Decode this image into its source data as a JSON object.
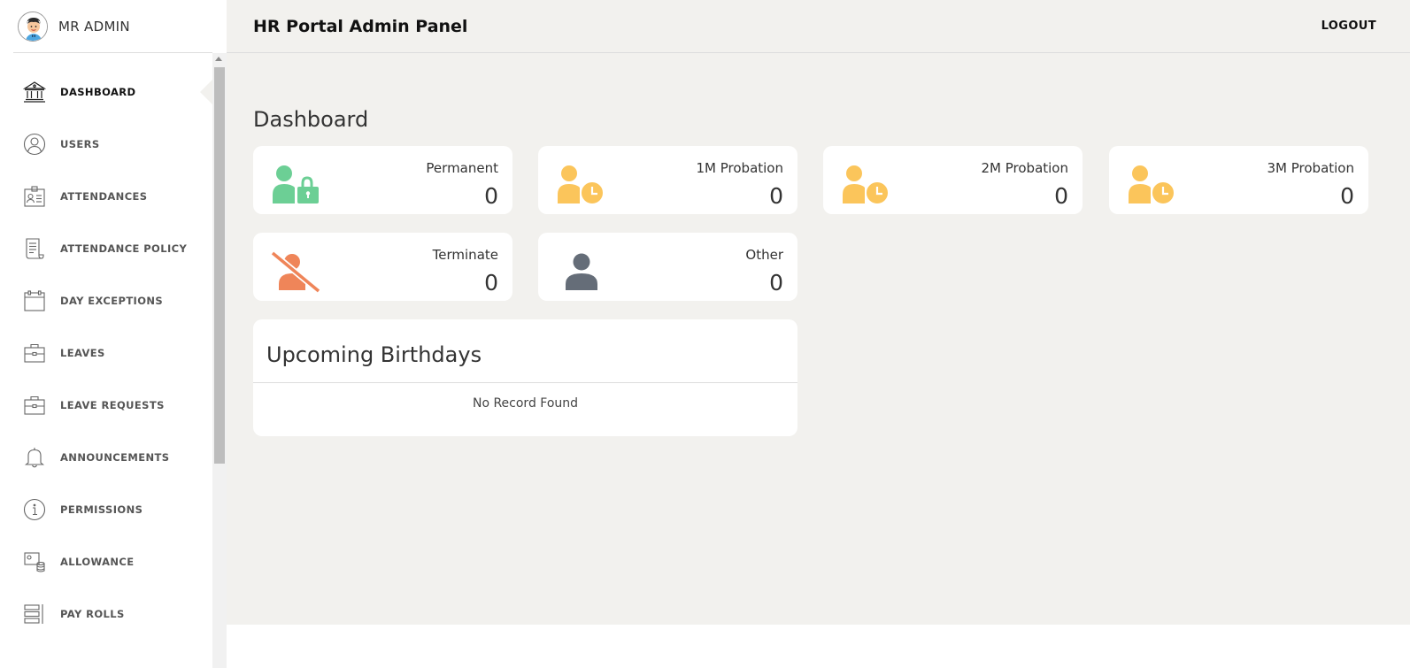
{
  "sidebar": {
    "user_name": "MR ADMIN",
    "items": [
      {
        "label": "DASHBOARD",
        "icon": "bank-icon"
      },
      {
        "label": "USERS",
        "icon": "user-circle-icon"
      },
      {
        "label": "ATTENDANCES",
        "icon": "id-card-icon"
      },
      {
        "label": "ATTENDANCE POLICY",
        "icon": "document-icon"
      },
      {
        "label": "DAY EXCEPTIONS",
        "icon": "calendar-icon"
      },
      {
        "label": "LEAVES",
        "icon": "briefcase-icon"
      },
      {
        "label": "LEAVE REQUESTS",
        "icon": "briefcase-icon"
      },
      {
        "label": "ANNOUNCEMENTS",
        "icon": "bell-icon"
      },
      {
        "label": "PERMISSIONS",
        "icon": "info-icon"
      },
      {
        "label": "ALLOWANCE",
        "icon": "allowance-icon"
      },
      {
        "label": "PAY ROLLS",
        "icon": "payroll-icon"
      }
    ],
    "active_item": "DASHBOARD"
  },
  "header": {
    "title": "HR Portal Admin Panel",
    "logout_label": "LOGOUT"
  },
  "main": {
    "page_title": "Dashboard",
    "stats": [
      {
        "label": "Permanent",
        "value": "0",
        "icon": "user-lock-icon",
        "color": "#6ccf95"
      },
      {
        "label": "1M Probation",
        "value": "0",
        "icon": "user-clock-icon",
        "color": "#fbc55b"
      },
      {
        "label": "2M Probation",
        "value": "0",
        "icon": "user-clock-icon",
        "color": "#fbc55b"
      },
      {
        "label": "3M Probation",
        "value": "0",
        "icon": "user-clock-icon",
        "color": "#fbc55b"
      },
      {
        "label": "Terminate",
        "value": "0",
        "icon": "user-slash-icon",
        "color": "#ef8559"
      },
      {
        "label": "Other",
        "value": "0",
        "icon": "user-icon",
        "color": "#656d78"
      }
    ],
    "birthdays": {
      "title": "Upcoming Birthdays",
      "empty_text": "No Record Found"
    }
  }
}
